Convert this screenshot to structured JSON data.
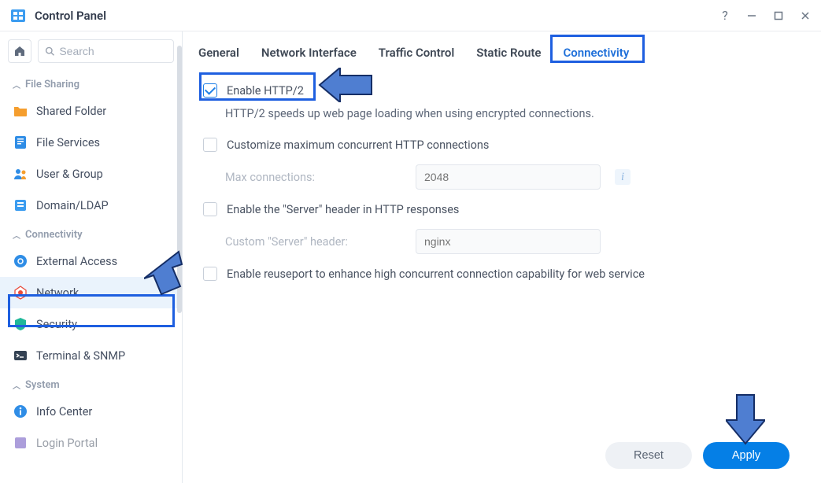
{
  "window": {
    "title": "Control Panel",
    "help": "?",
    "minimize": "—",
    "maximize": "▢",
    "close": "✕"
  },
  "sidebar": {
    "search_placeholder": "Search",
    "sections": {
      "file_sharing": "File Sharing",
      "connectivity": "Connectivity",
      "system": "System"
    },
    "items": {
      "shared_folder": "Shared Folder",
      "file_services": "File Services",
      "user_group": "User & Group",
      "domain_ldap": "Domain/LDAP",
      "external_access": "External Access",
      "network": "Network",
      "security": "Security",
      "terminal_snmp": "Terminal & SNMP",
      "info_center": "Info Center",
      "login_portal": "Login Portal"
    }
  },
  "tabs": {
    "general": "General",
    "network_interface": "Network Interface",
    "traffic_control": "Traffic Control",
    "static_route": "Static Route",
    "connectivity": "Connectivity"
  },
  "form": {
    "enable_http2": "Enable HTTP/2",
    "http2_desc": "HTTP/2 speeds up web page loading when using encrypted connections.",
    "customize_max": "Customize maximum concurrent HTTP connections",
    "max_conn_label": "Max connections:",
    "max_conn_value": "2048",
    "enable_server_header": "Enable the \"Server\" header in HTTP responses",
    "custom_server_label": "Custom \"Server\" header:",
    "custom_server_value": "nginx",
    "enable_reuseport": "Enable reuseport to enhance high concurrent connection capability for web service"
  },
  "footer": {
    "reset": "Reset",
    "apply": "Apply"
  },
  "colors": {
    "accent": "#057fe6",
    "highlight_border": "#1e5fe0"
  }
}
